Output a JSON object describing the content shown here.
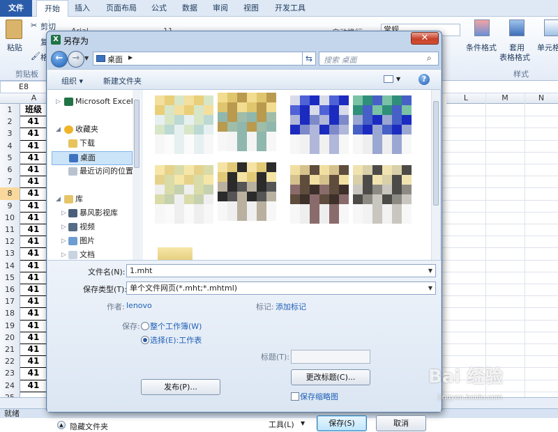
{
  "excel": {
    "tabs": [
      "文件",
      "开始",
      "插入",
      "页面布局",
      "公式",
      "数据",
      "审阅",
      "视图",
      "开发工具"
    ],
    "ribbon": {
      "paste": "粘贴",
      "cut": "剪切",
      "copy": "复",
      "format_painter": "格",
      "clipboard_group": "剪贴板",
      "font_name": "Arial",
      "font_size": "11",
      "wrap_text": "自动换行",
      "number_format": "常规",
      "conditional_format": "条件格式",
      "table_format_1": "套用",
      "table_format_2": "表格格式",
      "cell_styles": "单元格",
      "styles_group": "样式"
    },
    "name_box": "E8",
    "columns": [
      "A",
      "L",
      "M",
      "N"
    ],
    "header_cell": "班级",
    "rows": [
      "1",
      "2",
      "3",
      "4",
      "5",
      "6",
      "7",
      "8",
      "9",
      "10",
      "11",
      "12",
      "13",
      "14",
      "15",
      "16",
      "17",
      "18",
      "19",
      "20",
      "21",
      "22",
      "23",
      "24",
      "25"
    ],
    "values": [
      "41",
      "41",
      "41",
      "41",
      "41",
      "41",
      "41",
      "41",
      "41",
      "41",
      "41",
      "41",
      "41",
      "41",
      "41",
      "41",
      "41",
      "41",
      "41",
      "41",
      "41",
      "41",
      "41"
    ],
    "selected_row": "8",
    "status": "就绪"
  },
  "dialog": {
    "title": "另存为",
    "close_glyph": "✕",
    "address": "桌面",
    "search_placeholder": "搜索 桌面",
    "toolbar": {
      "organize": "组织 ▾",
      "new_folder": "新建文件夹"
    },
    "nav": {
      "excel": "Microsoft Excel",
      "favorites": "收藏夹",
      "downloads": "下载",
      "desktop": "桌面",
      "recent": "最近访问的位置",
      "libraries": "库",
      "video_lib": "暴风影视库",
      "videos": "视频",
      "pictures": "图片",
      "documents": "文档"
    },
    "form": {
      "filename_label": "文件名(N):",
      "filename_value": "1.mht",
      "type_label": "保存类型(T):",
      "type_value": "单个文件网页(*.mht;*.mhtml)",
      "author_label": "作者:",
      "author_value": "lenovo",
      "tags_label": "标记:",
      "tags_value": "添加标记",
      "save_label": "保存:",
      "opt_workbook": "整个工作簿(W)",
      "opt_selection": "选择(E):工作表",
      "title_label": "标题(T):",
      "change_title": "更改标题(C)...",
      "publish": "发布(P)...",
      "save_thumbnail": "保存缩略图",
      "hide_folders": "隐藏文件夹",
      "tools": "工具(L)",
      "save": "保存(S)",
      "cancel": "取消"
    }
  },
  "watermark": {
    "main": "Bai 经验",
    "sub": "jingyan.baidu.com"
  }
}
